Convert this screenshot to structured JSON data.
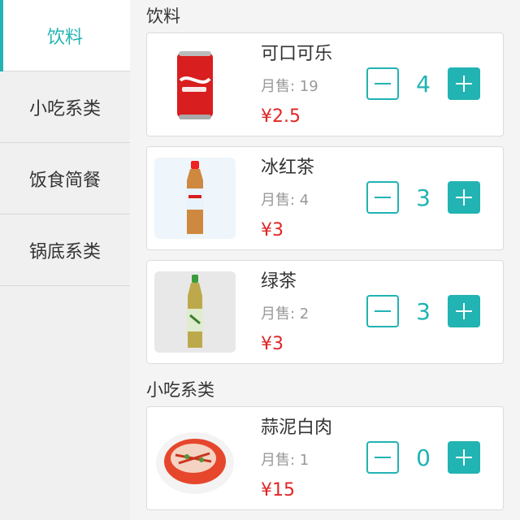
{
  "categories": [
    {
      "label": "饮料",
      "active": true
    },
    {
      "label": "小吃系类",
      "active": false
    },
    {
      "label": "饭食简餐",
      "active": false
    },
    {
      "label": "锅底系类",
      "active": false
    }
  ],
  "sections": [
    {
      "title": "饮料",
      "items": [
        {
          "name": "可口可乐",
          "sales": "月售: 19",
          "price": "¥2.5",
          "qty": "4",
          "icon": "cola-can-image"
        },
        {
          "name": "冰红茶",
          "sales": "月售: 4",
          "price": "¥3",
          "qty": "3",
          "icon": "ice-tea-bottle-image"
        },
        {
          "name": "绿茶",
          "sales": "月售: 2",
          "price": "¥3",
          "qty": "3",
          "icon": "green-tea-bottle-image"
        }
      ]
    },
    {
      "title": "小吃系类",
      "items": [
        {
          "name": "蒜泥白肉",
          "sales": "月售: 1",
          "price": "¥15",
          "qty": "0",
          "icon": "garlic-pork-dish-image"
        }
      ]
    }
  ],
  "colors": {
    "accent": "#22b3b3",
    "price": "#e02626"
  }
}
